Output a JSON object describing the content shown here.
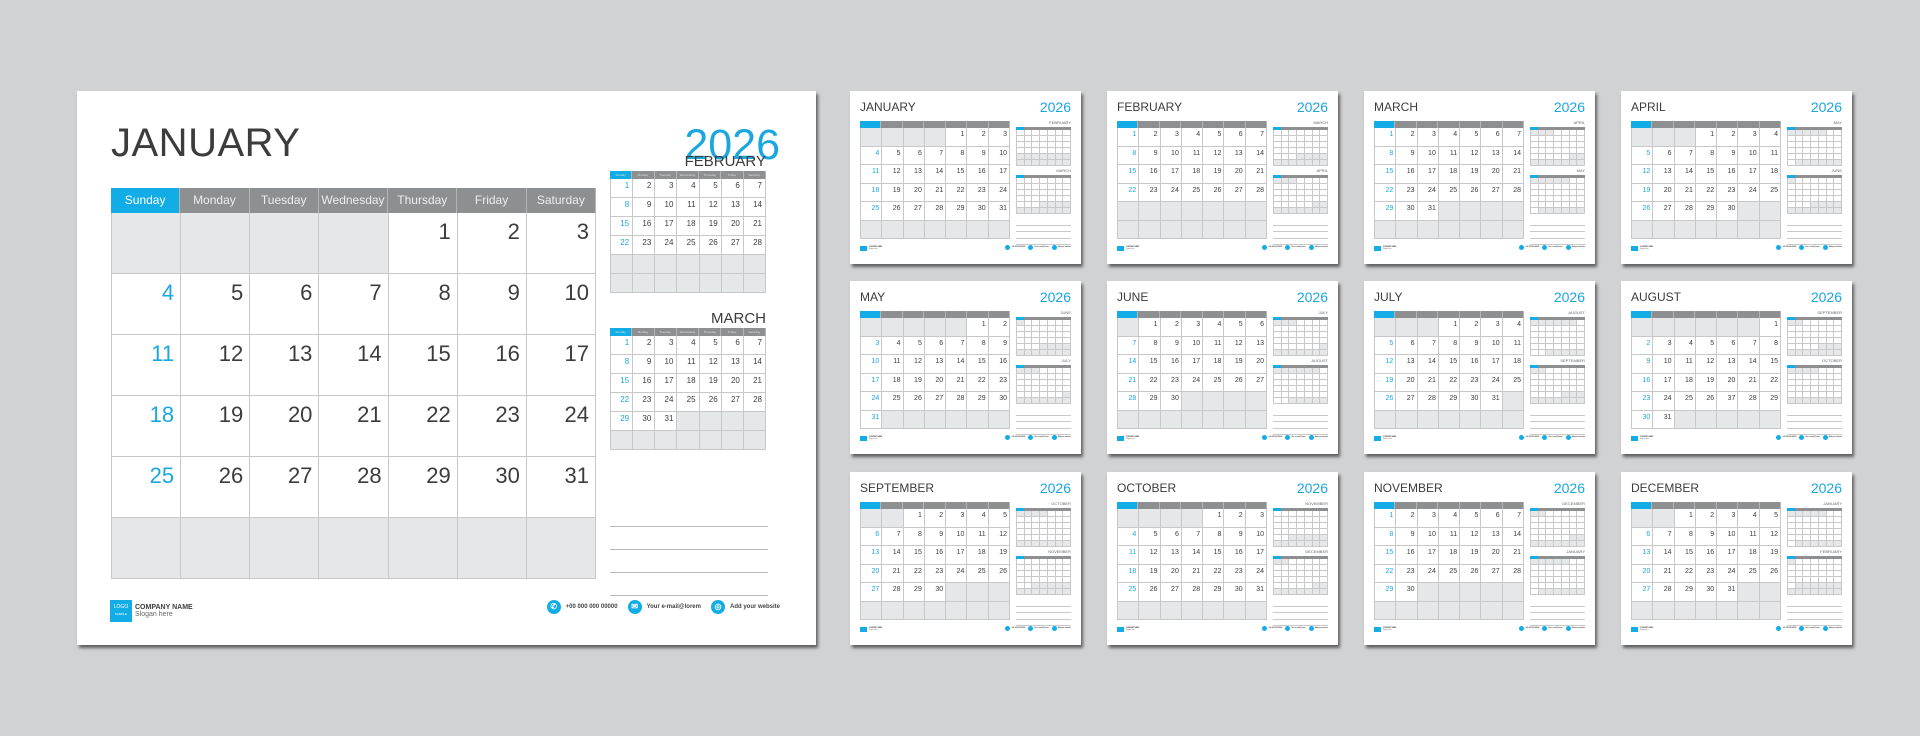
{
  "year": "2026",
  "weekdays": [
    "Sunday",
    "Monday",
    "Tuesday",
    "Wednesday",
    "Thursday",
    "Friday",
    "Saturday"
  ],
  "colors": {
    "accent": "#12ade6",
    "header_gray": "#8e8f91",
    "empty_cell": "#e6e7e8",
    "background": "#d1d2d4",
    "text": "#3c3c3c"
  },
  "footer": {
    "logo_line1": "LOGO",
    "logo_line2": "SAMPLE",
    "company_name": "COMPANY NAME",
    "slogan": "Slogan here",
    "phone": "+00 000 000 00000",
    "email": "Your e-mail@lorem",
    "website": "Add your website",
    "phone_icon": "phone-icon",
    "email_icon": "envelope-icon",
    "website_icon": "globe-icon"
  },
  "main": {
    "month": "JANUARY",
    "year": "2026",
    "start": 4,
    "days": 31,
    "rows": 6,
    "minis": [
      {
        "month": "FEBRUARY",
        "start": 0,
        "days": 28,
        "rows": 6
      },
      {
        "month": "MARCH",
        "start": 0,
        "days": 31,
        "rows": 6
      }
    ]
  },
  "months": [
    {
      "month": "JANUARY",
      "start": 4,
      "days": 31,
      "rows": 6,
      "minis": [
        {
          "month": "FEBRUARY",
          "start": 0,
          "days": 28,
          "rows": 6
        },
        {
          "month": "MARCH",
          "start": 0,
          "days": 31,
          "rows": 6
        }
      ]
    },
    {
      "month": "FEBRUARY",
      "start": 0,
      "days": 28,
      "rows": 6,
      "minis": [
        {
          "month": "MARCH",
          "start": 0,
          "days": 31,
          "rows": 6
        },
        {
          "month": "APRIL",
          "start": 3,
          "days": 30,
          "rows": 6
        }
      ]
    },
    {
      "month": "MARCH",
      "start": 0,
      "days": 31,
      "rows": 6,
      "minis": [
        {
          "month": "APRIL",
          "start": 3,
          "days": 30,
          "rows": 6
        },
        {
          "month": "MAY",
          "start": 5,
          "days": 31,
          "rows": 6
        }
      ]
    },
    {
      "month": "APRIL",
      "start": 3,
      "days": 30,
      "rows": 6,
      "minis": [
        {
          "month": "MAY",
          "start": 5,
          "days": 31,
          "rows": 6
        },
        {
          "month": "JUNE",
          "start": 1,
          "days": 30,
          "rows": 6
        }
      ]
    },
    {
      "month": "MAY",
      "start": 5,
      "days": 31,
      "rows": 6,
      "minis": [
        {
          "month": "JUNE",
          "start": 1,
          "days": 30,
          "rows": 6
        },
        {
          "month": "JULY",
          "start": 3,
          "days": 31,
          "rows": 6
        }
      ]
    },
    {
      "month": "JUNE",
      "start": 1,
      "days": 30,
      "rows": 6,
      "minis": [
        {
          "month": "JULY",
          "start": 3,
          "days": 31,
          "rows": 6
        },
        {
          "month": "AUGUST",
          "start": 6,
          "days": 31,
          "rows": 6
        }
      ]
    },
    {
      "month": "JULY",
      "start": 3,
      "days": 31,
      "rows": 6,
      "minis": [
        {
          "month": "AUGUST",
          "start": 6,
          "days": 31,
          "rows": 6
        },
        {
          "month": "SEPTEMBER",
          "start": 2,
          "days": 30,
          "rows": 6
        }
      ]
    },
    {
      "month": "AUGUST",
      "start": 6,
      "days": 31,
      "rows": 6,
      "overrides": {
        "27": "37"
      },
      "minis": [
        {
          "month": "SEPTEMBER",
          "start": 2,
          "days": 30,
          "rows": 6
        },
        {
          "month": "OCTOBER",
          "start": 4,
          "days": 31,
          "rows": 6
        }
      ]
    },
    {
      "month": "SEPTEMBER",
      "start": 2,
      "days": 30,
      "rows": 6,
      "minis": [
        {
          "month": "OCTOBER",
          "start": 4,
          "days": 31,
          "rows": 6
        },
        {
          "month": "NOVEMBER",
          "start": 0,
          "days": 30,
          "rows": 6
        }
      ]
    },
    {
      "month": "OCTOBER",
      "start": 4,
      "days": 31,
      "rows": 6,
      "minis": [
        {
          "month": "NOVEMBER",
          "start": 0,
          "days": 30,
          "rows": 6
        },
        {
          "month": "DECEMBER",
          "start": 2,
          "days": 31,
          "rows": 6
        }
      ]
    },
    {
      "month": "NOVEMBER",
      "start": 0,
      "days": 30,
      "rows": 6,
      "minis": [
        {
          "month": "DECEMBER",
          "start": 2,
          "days": 31,
          "rows": 6
        },
        {
          "month": "JANUARY",
          "start": 5,
          "days": 31,
          "rows": 6
        }
      ]
    },
    {
      "month": "DECEMBER",
      "start": 2,
      "days": 31,
      "rows": 6,
      "minis": [
        {
          "month": "JANUARY",
          "start": 5,
          "days": 31,
          "rows": 6
        },
        {
          "month": "FEBRUARY",
          "start": 1,
          "days": 28,
          "rows": 6
        }
      ]
    }
  ]
}
